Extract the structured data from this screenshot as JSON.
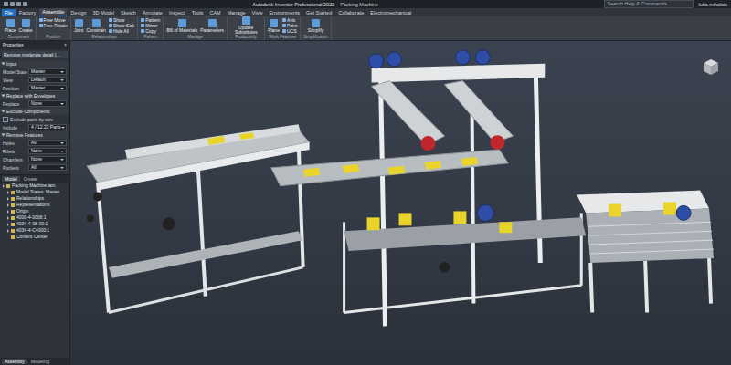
{
  "window": {
    "title": "Autodesk Inventor Professional 2023",
    "document": "Packing Machine"
  },
  "search": {
    "placeholder": "Search Help & Commands..."
  },
  "user": {
    "name": "luka.mihalcic"
  },
  "tabs": [
    {
      "label": "File",
      "kind": "file",
      "selected": false
    },
    {
      "label": "Factory",
      "kind": "tab",
      "selected": false
    },
    {
      "label": "Assemble",
      "kind": "tab",
      "selected": true
    },
    {
      "label": "Design",
      "kind": "tab",
      "selected": false
    },
    {
      "label": "3D Model",
      "kind": "tab",
      "selected": false
    },
    {
      "label": "Sketch",
      "kind": "tab",
      "selected": false
    },
    {
      "label": "Annotate",
      "kind": "tab",
      "selected": false
    },
    {
      "label": "Inspect",
      "kind": "tab",
      "selected": false
    },
    {
      "label": "Tools",
      "kind": "tab",
      "selected": false
    },
    {
      "label": "CAM",
      "kind": "tab",
      "selected": false
    },
    {
      "label": "Manage",
      "kind": "tab",
      "selected": false
    },
    {
      "label": "View",
      "kind": "tab",
      "selected": false
    },
    {
      "label": "Environments",
      "kind": "tab",
      "selected": false
    },
    {
      "label": "Get Started",
      "kind": "tab",
      "selected": false
    },
    {
      "label": "Collaborate",
      "kind": "tab",
      "selected": false
    },
    {
      "label": "Electromechanical",
      "kind": "tab",
      "selected": false
    }
  ],
  "ribbon": {
    "groups": [
      {
        "label": "Component",
        "buttons": [
          {
            "label": "Place",
            "kind": "large"
          },
          {
            "label": "Create",
            "kind": "large"
          }
        ]
      },
      {
        "label": "Position",
        "buttons": [
          {
            "label": "Free Move",
            "kind": "small"
          },
          {
            "label": "Free Rotate",
            "kind": "small"
          }
        ]
      },
      {
        "label": "Relationships",
        "buttons": [
          {
            "label": "Joint",
            "kind": "large"
          },
          {
            "label": "Constrain",
            "kind": "large"
          },
          {
            "label": "Show",
            "kind": "small"
          },
          {
            "label": "Show Sick",
            "kind": "small"
          },
          {
            "label": "Hide All",
            "kind": "small"
          }
        ]
      },
      {
        "label": "Pattern",
        "buttons": [
          {
            "label": "Pattern",
            "kind": "small"
          },
          {
            "label": "Mirror",
            "kind": "small"
          },
          {
            "label": "Copy",
            "kind": "small"
          }
        ]
      },
      {
        "label": "Manage",
        "buttons": [
          {
            "label": "Bill of Materials",
            "kind": "large"
          },
          {
            "label": "Parameters",
            "kind": "large"
          }
        ]
      },
      {
        "label": "Productivity",
        "buttons": [
          {
            "label": "Update Substitutes",
            "kind": "large"
          }
        ]
      },
      {
        "label": "Work Features",
        "buttons": [
          {
            "label": "Plane",
            "kind": "large"
          },
          {
            "label": "Axis",
            "kind": "small"
          },
          {
            "label": "Point",
            "kind": "small"
          },
          {
            "label": "UCS",
            "kind": "small"
          }
        ]
      },
      {
        "label": "Simplification",
        "buttons": [
          {
            "label": "Simplify",
            "kind": "large"
          }
        ]
      }
    ]
  },
  "properties": {
    "title": "Properties",
    "close": "×",
    "subject": "Remove moderate detail (…",
    "sections": [
      {
        "label": "Input",
        "expanded": true,
        "rows": [
          {
            "kind": "field",
            "label": "Model State",
            "value": "Master"
          },
          {
            "kind": "field",
            "label": "View",
            "value": "Default"
          },
          {
            "kind": "field",
            "label": "Position",
            "value": "Master"
          }
        ]
      },
      {
        "label": "Replace with Envelopes",
        "expanded": true,
        "rows": [
          {
            "kind": "field",
            "label": "Replace",
            "value": "None"
          }
        ]
      },
      {
        "label": "Exclude Components",
        "expanded": true,
        "rows": [
          {
            "kind": "checkbox",
            "label": "Exclude parts by size",
            "checked": false
          },
          {
            "kind": "field",
            "label": "Include",
            "value": "4 / 12.22 Parts"
          }
        ]
      },
      {
        "label": "Remove Features",
        "expanded": true,
        "rows": [
          {
            "kind": "field",
            "label": "Holes",
            "value": "All"
          },
          {
            "kind": "field",
            "label": "Fillets",
            "value": "None"
          },
          {
            "kind": "field",
            "label": "Chamfers",
            "value": "None"
          },
          {
            "kind": "field",
            "label": "Pockets",
            "value": "All"
          }
        ]
      }
    ]
  },
  "browser": {
    "tabs": [
      {
        "label": "Model",
        "selected": true
      },
      {
        "label": "Create",
        "selected": false
      }
    ],
    "items": [
      {
        "label": "Packing Machine.iam",
        "depth": 0,
        "has_children": true
      },
      {
        "label": "Model States: Master",
        "depth": 1,
        "has_children": true
      },
      {
        "label": "Relationships",
        "depth": 1,
        "has_children": true
      },
      {
        "label": "Representations",
        "depth": 1,
        "has_children": true
      },
      {
        "label": "Origin",
        "depth": 1,
        "has_children": true
      },
      {
        "label": "4000-4-0008:1",
        "depth": 1,
        "has_children": true
      },
      {
        "label": "4034-4-08-00:1",
        "depth": 1,
        "has_children": true
      },
      {
        "label": "4034-4-C4000:1",
        "depth": 1,
        "has_children": true
      },
      {
        "label": "Content Center",
        "depth": 1,
        "has_children": false
      }
    ],
    "bottom_tabs": [
      {
        "label": "Assembly",
        "selected": true
      },
      {
        "label": "Modeling",
        "selected": false
      }
    ]
  }
}
